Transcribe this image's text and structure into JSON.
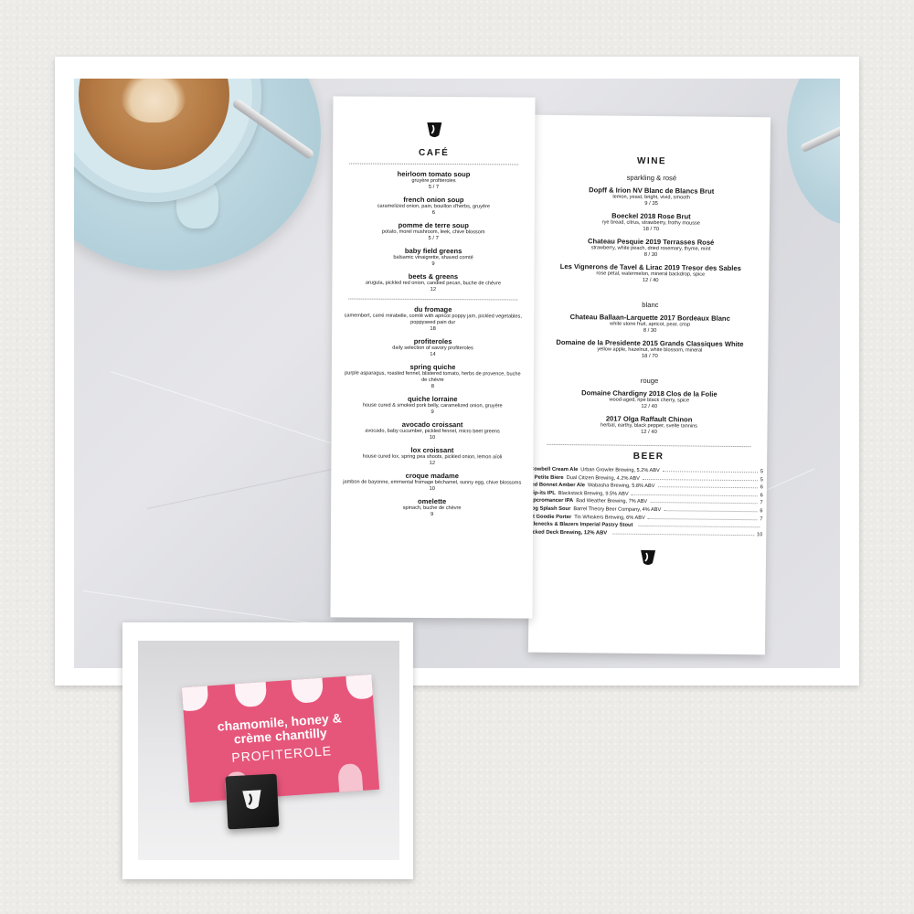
{
  "cafe_menu": {
    "title": "CAFÉ",
    "sections": [
      {
        "items": [
          {
            "name": "heirloom tomato soup",
            "desc": "gruyère profiteroles",
            "price": "5 / 7"
          },
          {
            "name": "french onion soup",
            "desc": "caramelized onion, pain, bouillon d'herbs, gruyère",
            "price": "6"
          },
          {
            "name": "pomme de terre soup",
            "desc": "potato, morel mushroom, leek, chive blossom",
            "price": "5 / 7"
          },
          {
            "name": "baby field greens",
            "desc": "balsamic vinaigrette, shaved comté",
            "price": "9"
          },
          {
            "name": "beets & greens",
            "desc": "arugula, pickled red onion, candied pecan, buche de chèvre",
            "price": "12"
          }
        ]
      },
      {
        "items": [
          {
            "name": "du fromage",
            "desc": "camembert, carré mirabelle, comté with apricot poppy jam, pickled vegetables, poppyseed pain dur",
            "price": "18"
          },
          {
            "name": "profiteroles",
            "desc": "daily selection of savory profiteroles",
            "price": "14"
          },
          {
            "name": "spring quiche",
            "desc": "purple asparagus, roasted fennel, blistered tomato, herbs de provence, buche de chèvre",
            "price": "8"
          },
          {
            "name": "quiche lorraine",
            "desc": "house cured & smoked pork belly, caramelized onion, gruyère",
            "price": "9"
          },
          {
            "name": "avocado croissant",
            "desc": "avocado, baby cucumber, pickled fennel, micro beet greens",
            "price": "10"
          },
          {
            "name": "lox croissant",
            "desc": "house cured lox, spring pea shoots, pickled onion, lemon aïoli",
            "price": "12"
          },
          {
            "name": "croque madame",
            "desc": "jambon de bayonne, emmental fromage béchamel, sunny egg, chive blossoms",
            "price": "10"
          },
          {
            "name": "omelette",
            "desc": "spinach, buche de chèvre",
            "price": "9"
          }
        ]
      }
    ]
  },
  "wine_menu": {
    "title": "WINE",
    "sections": [
      {
        "heading": "sparkling & rosé",
        "items": [
          {
            "name": "Dopff & Irion NV Blanc de Blancs Brut",
            "desc": "lemon, yeast, bright, vivid, smooth",
            "price": "9 / 35"
          },
          {
            "name": "Boeckel 2018 Rose Brut",
            "desc": "rye bread, citrus, strawberry, frothy mousse",
            "price": "18 / 70"
          },
          {
            "name": "Chateau Pesquie 2019 Terrasses Rosé",
            "desc": "strawberry, white peach, dried rosemary, thyme, mint",
            "price": "8 / 30"
          },
          {
            "name": "Les Vignerons de Tavel & Lirac 2019 Tresor des Sables",
            "desc": "rose petal, watermelon, mineral backdrop, spice",
            "price": "12 / 40"
          }
        ]
      },
      {
        "heading": "blanc",
        "items": [
          {
            "name": "Chateau Ballaan-Larquette 2017 Bordeaux Blanc",
            "desc": "white stone fruit, apricot, pear, crisp",
            "price": "8 / 30"
          },
          {
            "name": "Domaine de la Presidente 2015 Grands Classiques White",
            "desc": "yellow apple, hazelnut, white blossom, mineral",
            "price": "18 / 70"
          }
        ]
      },
      {
        "heading": "rouge",
        "items": [
          {
            "name": "Domaine Chardigny 2018 Clos de la Folie",
            "desc": "wood-aged, ripe black cherry, spice",
            "price": "12 / 40"
          },
          {
            "name": "2017 Olga Raffault Chinon",
            "desc": "herbal, earthy, black pepper, svelte tannins",
            "price": "12 / 40"
          }
        ]
      }
    ],
    "beer_title": "BEER",
    "beers": [
      {
        "name": "Cowbell Cream Ale",
        "brewer": "Urban Growler Brewing, 5.2% ABV",
        "price": "5"
      },
      {
        "name": "e Petite Biere",
        "brewer": "Dual Citizen Brewing, 4.2% ABV",
        "price": "5"
      },
      {
        "name": "led Bonnet Amber Ale",
        "brewer": "Wabasha Brewing, 5.8% ABV",
        "price": "6"
      },
      {
        "name": "hip-its IPL",
        "brewer": "Blackstack Brewing, 9.5% ABV",
        "price": "6"
      },
      {
        "name": "opcromancer IPA",
        "brewer": "Bad Weather Brewing, 7% ABV",
        "price": "7"
      },
      {
        "name": "rog Splash Sour",
        "brewer": "Barrel Theory Beer Company, 4% ABV",
        "price": "6"
      },
      {
        "name": "ut Goodie Porter",
        "brewer": "Tin Whiskers Brewing, 6% ABV",
        "price": "7"
      },
      {
        "name": "rtlenecks & Blazers Imperial Pastry Stout",
        "brewer": "",
        "price": ""
      },
      {
        "name": "acked Deck Brewing, 12% ABV",
        "brewer": "",
        "price": "10"
      }
    ]
  },
  "card": {
    "line1": "chamomile, honey &",
    "line2": "crème chantilly",
    "line3": "PROFITEROLE",
    "color": "#e6567a"
  },
  "colors": {
    "background": "#ecebe8",
    "saucer": "#b7d3dd"
  }
}
